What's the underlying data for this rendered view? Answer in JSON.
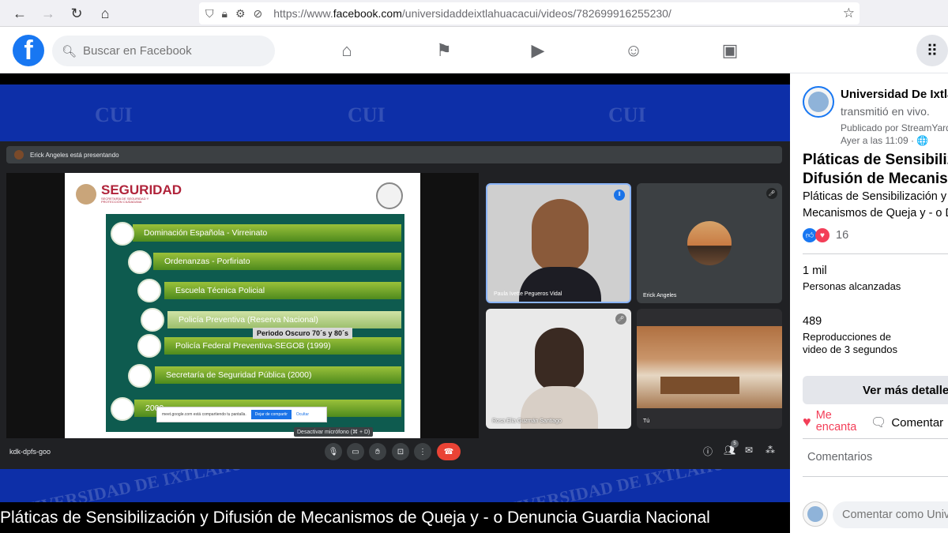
{
  "browser": {
    "url_prefix": "https://www.",
    "url_domain": "facebook.com",
    "url_path": "/universidaddeixtlahuacacui/videos/782699916255230/"
  },
  "facebook": {
    "logo": "f",
    "search_placeholder": "Buscar en Facebook",
    "nav_icons": [
      "home-icon",
      "flag-icon",
      "watch-icon",
      "groups-icon",
      "gaming-icon"
    ]
  },
  "video": {
    "watermark": "CUI",
    "bottom_watermark": "UNIVERSIDAD DE IXTLAHUACA",
    "meet": {
      "presenting_text": "Erick Angeles está presentando",
      "slide": {
        "title": "SEGURIDAD",
        "subtitle": "SECRETARÍA DE SEGURIDAD Y PROTECCIÓN CIUDADANA",
        "steps": [
          "Dominación Española - Virreinato",
          "Ordenanzas - Porfiriato",
          "Escuela Técnica Policial",
          "Policía Preventiva (Reserva Nacional)",
          "Policía Federal Preventiva-SEGOB (1999)",
          "Secretaría de Seguridad Pública (2000)",
          "2009"
        ],
        "overlay_label": "Periodo Oscuro 70´s y 80´s",
        "share_text": "meet.google.com está compartiendo tu pantalla.",
        "share_stop": "Dejar de compartir",
        "share_hide": "Ocultar"
      },
      "participants": [
        "Paula Ivette Pegueros Vidal",
        "Erick Angeles",
        "Rosa Elia Guzmán Santiago",
        "Tú"
      ],
      "meeting_code": "kdk-dpfs-goo",
      "mute_tooltip": "Desactivar micrófono (⌘ + D)",
      "people_count": "5"
    },
    "caption": "Pláticas de Sensibilización y Difusión de Mecanismos de Queja y - o Denuncia Guardia Nacional"
  },
  "sidebar": {
    "page_name": "Universidad De Ixtlahuaca CUI",
    "live_text": "transmitió en vivo.",
    "published_by": "Publicado por StreamYard",
    "time": "Ayer a las 11:09 · 🌐",
    "video_title_line1": "Pláticas de Sensibilización y",
    "video_title_line2": "Difusión de Mecanismos",
    "description_line1": "Pláticas de Sensibilización y Difusión de",
    "description_line2": "Mecanismos de Queja y - o Denuncia",
    "reaction_count": "16",
    "stat1_value": "1 mil",
    "stat1_label": "Personas alcanzadas",
    "stat2_value": "489",
    "stat2_label_line1": "Reproducciones de",
    "stat2_label_line2": "video de 3 segundos",
    "more_details": "Ver más detalles",
    "like_label_line1": "Me",
    "like_label_line2": "encanta",
    "comment_label": "Comentar",
    "comments_header": "Comentarios",
    "comment_placeholder": "Comentar como Universidad"
  }
}
